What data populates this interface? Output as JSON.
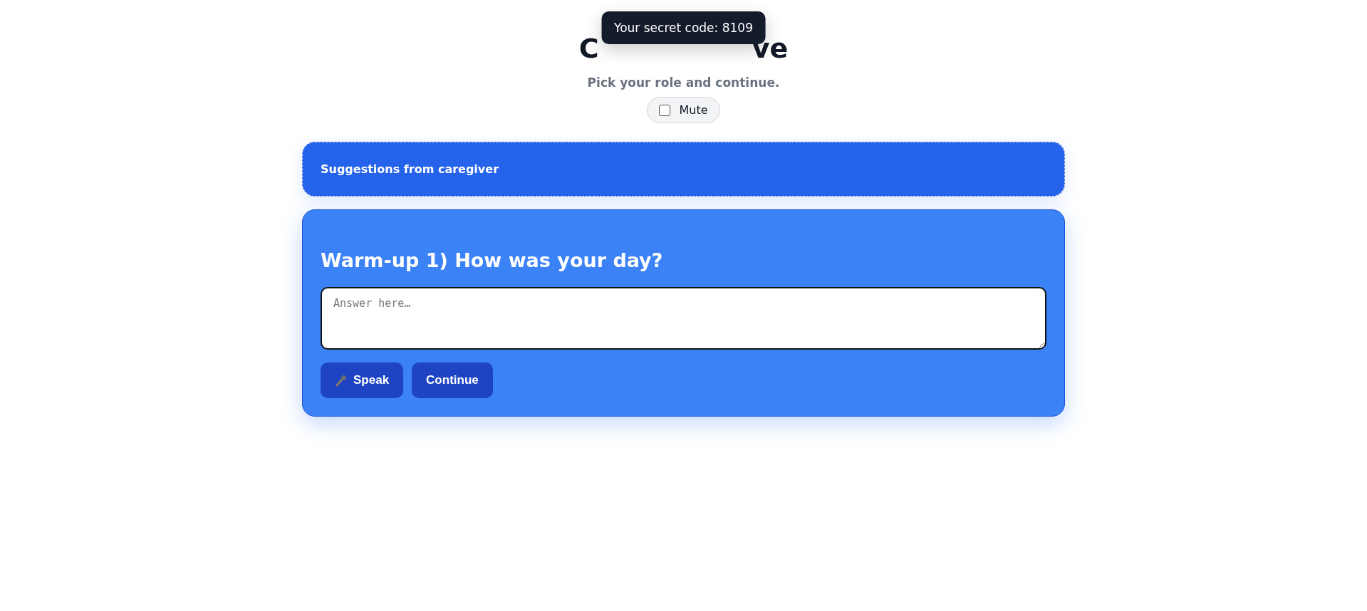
{
  "header": {
    "title_visible_start": "C",
    "title_visible_end": "ve",
    "tooltip": "Your secret code: 8109",
    "subtitle": "Pick your role and continue.",
    "mute": {
      "label": "Mute",
      "checked": false
    }
  },
  "suggestions": {
    "title": "Suggestions from caregiver"
  },
  "question": {
    "title": "Warm-up 1) How was your day?",
    "answer": {
      "placeholder": "Answer here…"
    },
    "buttons": [
      {
        "kind": "speak",
        "label": "Speak"
      },
      {
        "kind": "plain",
        "label": "Continue"
      }
    ]
  }
}
